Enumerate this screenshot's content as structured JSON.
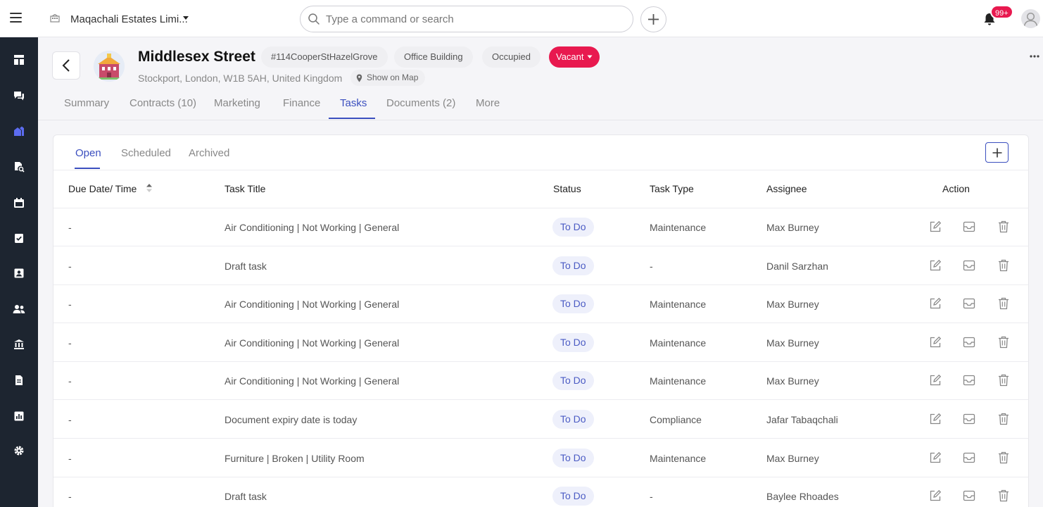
{
  "topbar": {
    "company_name": "Maqachali Estates Limi...",
    "search_placeholder": "Type a command or search",
    "notification_count": "99+"
  },
  "sidebar": {
    "items": [
      {
        "icon": "dashboard-icon",
        "active": false
      },
      {
        "icon": "chat-icon",
        "active": false
      },
      {
        "icon": "properties-icon",
        "active": true
      },
      {
        "icon": "search-document-icon",
        "active": false
      },
      {
        "icon": "calendar-icon",
        "active": false
      },
      {
        "icon": "tasks-icon",
        "active": false
      },
      {
        "icon": "contacts-icon",
        "active": false
      },
      {
        "icon": "people-icon",
        "active": false
      },
      {
        "icon": "bank-icon",
        "active": false
      },
      {
        "icon": "document-icon",
        "active": false
      },
      {
        "icon": "reports-icon",
        "active": false
      },
      {
        "icon": "settings-icon",
        "active": false
      }
    ]
  },
  "property": {
    "title": "Middlesex Street",
    "reference": "#114CooperStHazelGrove",
    "type": "Office Building",
    "occupancy": "Occupied",
    "status": "Vacant",
    "address": "Stockport, London, W1B 5AH, United Kingdom",
    "map_label": "Show on Map"
  },
  "tabs": [
    {
      "label": "Summary",
      "active": false
    },
    {
      "label": "Contracts (10)",
      "active": false
    },
    {
      "label": "Marketing",
      "active": false
    },
    {
      "label": "Finance",
      "active": false
    },
    {
      "label": "Tasks",
      "active": true
    },
    {
      "label": "Documents (2)",
      "active": false
    },
    {
      "label": "More",
      "active": false
    }
  ],
  "task_tabs": [
    {
      "label": "Open",
      "active": true
    },
    {
      "label": "Scheduled",
      "active": false
    },
    {
      "label": "Archived",
      "active": false
    }
  ],
  "table": {
    "headers": {
      "due": "Due Date/ Time",
      "title": "Task Title",
      "status": "Status",
      "type": "Task Type",
      "assignee": "Assignee",
      "action": "Action"
    },
    "rows": [
      {
        "due": "-",
        "title": "Air Conditioning | Not Working | General",
        "status": "To Do",
        "type": "Maintenance",
        "assignee": "Max Burney"
      },
      {
        "due": "-",
        "title": "Draft task",
        "status": "To Do",
        "type": "-",
        "assignee": "Danil Sarzhan"
      },
      {
        "due": "-",
        "title": "Air Conditioning | Not Working | General",
        "status": "To Do",
        "type": "Maintenance",
        "assignee": "Max Burney"
      },
      {
        "due": "-",
        "title": "Air Conditioning | Not Working | General",
        "status": "To Do",
        "type": "Maintenance",
        "assignee": "Max Burney"
      },
      {
        "due": "-",
        "title": "Air Conditioning | Not Working | General",
        "status": "To Do",
        "type": "Maintenance",
        "assignee": "Max Burney"
      },
      {
        "due": "-",
        "title": "Document expiry date is today",
        "status": "To Do",
        "type": "Compliance",
        "assignee": "Jafar Tabaqchali"
      },
      {
        "due": "-",
        "title": "Furniture | Broken | Utility Room",
        "status": "To Do",
        "type": "Maintenance",
        "assignee": "Max Burney"
      },
      {
        "due": "-",
        "title": "Draft task",
        "status": "To Do",
        "type": "-",
        "assignee": "Baylee Rhoades"
      }
    ]
  },
  "colors": {
    "accent": "#3b4fbf",
    "status_vacant": "#e8194f",
    "sidebar_bg": "#1d2530",
    "sidebar_active": "#5c6cf0"
  }
}
